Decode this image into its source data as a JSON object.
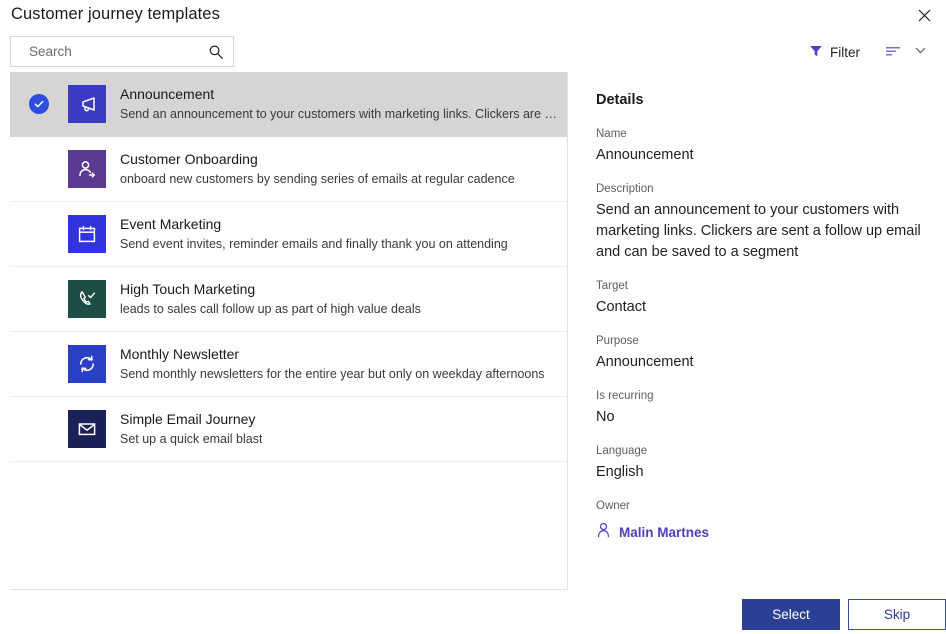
{
  "window": {
    "title": "Customer journey templates",
    "close_icon": "close-icon"
  },
  "commandbar": {
    "search_placeholder": "Search",
    "search_value": "",
    "search_icon": "search-icon",
    "filter_label": "Filter",
    "filter_icon": "filter-funnel-icon",
    "sort_icon": "sort-lines-icon",
    "chevron_icon": "chevron-down-icon",
    "filter_icon_color": "#4b3fc4",
    "sort_icon_color": "#7b6fd6"
  },
  "list": {
    "items": [
      {
        "name": "Announcement",
        "description": "Send an announcement to your customers with marketing links. Clickers are sent a...",
        "icon": "megaphone-icon",
        "tile_color": "#3a3ac4",
        "selected": true
      },
      {
        "name": "Customer Onboarding",
        "description": "onboard new customers by sending series of emails at regular cadence",
        "icon": "person-arrow-icon",
        "tile_color": "#5b3a91",
        "selected": false
      },
      {
        "name": "Event Marketing",
        "description": "Send event invites, reminder emails and finally thank you on attending",
        "icon": "calendar-icon",
        "tile_color": "#3333dd",
        "selected": false
      },
      {
        "name": "High Touch Marketing",
        "description": "leads to sales call follow up as part of high value deals",
        "icon": "phone-check-icon",
        "tile_color": "#1d4e46",
        "selected": false
      },
      {
        "name": "Monthly Newsletter",
        "description": "Send monthly newsletters for the entire year but only on weekday afternoons",
        "icon": "refresh-sync-icon",
        "tile_color": "#2a3fc4",
        "selected": false
      },
      {
        "name": "Simple Email Journey",
        "description": "Set up a quick email blast",
        "icon": "envelope-icon",
        "tile_color": "#1b2056",
        "selected": false
      }
    ],
    "selected_check_icon": "check-circle-icon",
    "selected_check_color": "#2c4ddf",
    "selected_row_background": "#d7d5d3"
  },
  "details": {
    "heading": "Details",
    "fields": [
      {
        "label": "Name",
        "value": "Announcement"
      },
      {
        "label": "Description",
        "value": "Send an announcement to your customers with marketing links. Clickers are sent a follow up email and can be saved to a segment"
      },
      {
        "label": "Target",
        "value": "Contact"
      },
      {
        "label": "Purpose",
        "value": "Announcement"
      },
      {
        "label": "Is recurring",
        "value": "No"
      },
      {
        "label": "Language",
        "value": "English"
      }
    ],
    "owner": {
      "label": "Owner",
      "name": "Malin Martnes",
      "icon": "person-icon",
      "color": "#4b3fc4"
    }
  },
  "footer": {
    "select_label": "Select",
    "skip_label": "Skip",
    "primary_color": "#2b4094"
  }
}
